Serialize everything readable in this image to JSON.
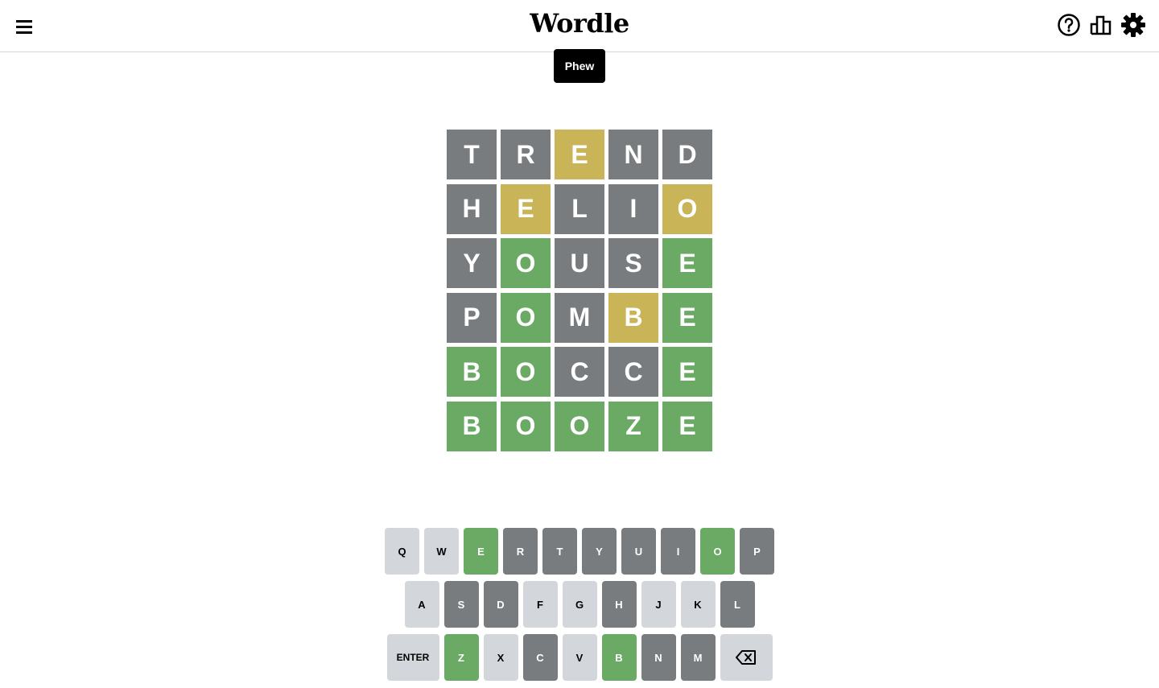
{
  "header": {
    "title": "Wordle",
    "menu_icon": "hamburger-menu-icon",
    "help_icon": "help-icon",
    "stats_icon": "stats-icon",
    "settings_icon": "gear-icon"
  },
  "toast": "Phew",
  "board": {
    "rows": [
      {
        "letters": [
          "T",
          "R",
          "E",
          "N",
          "D"
        ],
        "states": [
          "absent",
          "absent",
          "present",
          "absent",
          "absent"
        ]
      },
      {
        "letters": [
          "H",
          "E",
          "L",
          "I",
          "O"
        ],
        "states": [
          "absent",
          "present",
          "absent",
          "absent",
          "present"
        ]
      },
      {
        "letters": [
          "Y",
          "O",
          "U",
          "S",
          "E"
        ],
        "states": [
          "absent",
          "correct",
          "absent",
          "absent",
          "correct"
        ]
      },
      {
        "letters": [
          "P",
          "O",
          "M",
          "B",
          "E"
        ],
        "states": [
          "absent",
          "correct",
          "absent",
          "present",
          "correct"
        ]
      },
      {
        "letters": [
          "B",
          "O",
          "C",
          "C",
          "E"
        ],
        "states": [
          "correct",
          "correct",
          "absent",
          "absent",
          "correct"
        ]
      },
      {
        "letters": [
          "B",
          "O",
          "O",
          "Z",
          "E"
        ],
        "states": [
          "correct",
          "correct",
          "correct",
          "correct",
          "correct"
        ]
      }
    ]
  },
  "keyboard": {
    "rows": [
      [
        {
          "label": "q",
          "state": "unused"
        },
        {
          "label": "w",
          "state": "unused"
        },
        {
          "label": "e",
          "state": "correct"
        },
        {
          "label": "r",
          "state": "absent"
        },
        {
          "label": "t",
          "state": "absent"
        },
        {
          "label": "y",
          "state": "absent"
        },
        {
          "label": "u",
          "state": "absent"
        },
        {
          "label": "i",
          "state": "absent"
        },
        {
          "label": "o",
          "state": "correct"
        },
        {
          "label": "p",
          "state": "absent"
        }
      ],
      [
        {
          "label": "a",
          "state": "unused"
        },
        {
          "label": "s",
          "state": "absent"
        },
        {
          "label": "d",
          "state": "absent"
        },
        {
          "label": "f",
          "state": "unused"
        },
        {
          "label": "g",
          "state": "unused"
        },
        {
          "label": "h",
          "state": "absent"
        },
        {
          "label": "j",
          "state": "unused"
        },
        {
          "label": "k",
          "state": "unused"
        },
        {
          "label": "l",
          "state": "absent"
        }
      ],
      [
        {
          "label": "enter",
          "state": "unused",
          "wide": true
        },
        {
          "label": "z",
          "state": "correct"
        },
        {
          "label": "x",
          "state": "unused"
        },
        {
          "label": "c",
          "state": "absent"
        },
        {
          "label": "v",
          "state": "unused"
        },
        {
          "label": "b",
          "state": "correct"
        },
        {
          "label": "n",
          "state": "absent"
        },
        {
          "label": "m",
          "state": "absent"
        },
        {
          "label": "",
          "icon": "backspace-icon",
          "state": "unused",
          "wide": true
        }
      ]
    ]
  },
  "colors": {
    "correct": "#6aaa64",
    "present": "#c9b458",
    "absent": "#787c7e",
    "unused": "#d3d6da"
  }
}
